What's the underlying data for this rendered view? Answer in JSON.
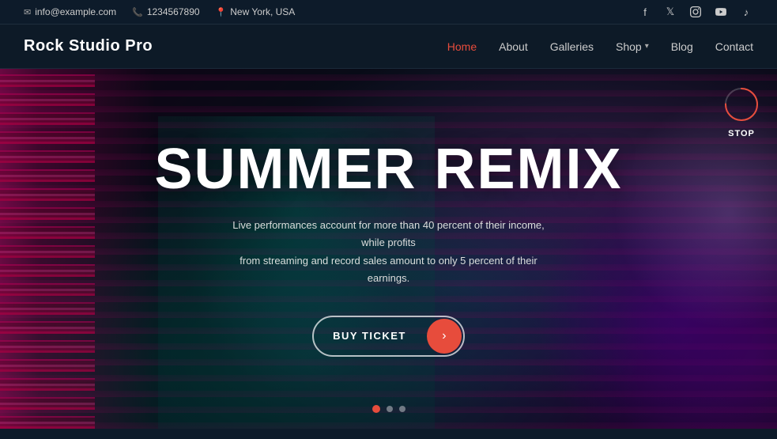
{
  "topbar": {
    "email": "info@example.com",
    "phone": "1234567890",
    "location": "New York, USA",
    "email_icon": "✉",
    "phone_icon": "📞",
    "location_icon": "📍"
  },
  "social": {
    "facebook": "f",
    "twitter": "𝕏",
    "instagram": "◎",
    "youtube": "▶",
    "tiktok": "♪"
  },
  "navbar": {
    "logo": "Rock Studio Pro",
    "links": [
      {
        "label": "Home",
        "active": true
      },
      {
        "label": "About",
        "active": false
      },
      {
        "label": "Galleries",
        "active": false
      },
      {
        "label": "Shop",
        "active": false,
        "dropdown": true
      },
      {
        "label": "Blog",
        "active": false
      },
      {
        "label": "Contact",
        "active": false
      }
    ]
  },
  "hero": {
    "title": "SUMMER REMIX",
    "subtitle_line1": "Live performances account for more than 40 percent of their income, while profits",
    "subtitle_line2": "from streaming and record sales amount to only 5 percent of their earnings.",
    "cta_label": "BUY TICKET",
    "cta_arrow": "›"
  },
  "slideshow": {
    "stop_label": "Stop",
    "dots": [
      {
        "active": true
      },
      {
        "active": false
      },
      {
        "active": false
      }
    ]
  },
  "colors": {
    "accent": "#e74c3c",
    "bg_dark": "#0d1b2a",
    "text_light": "#ffffff",
    "nav_active": "#e74c3c"
  }
}
